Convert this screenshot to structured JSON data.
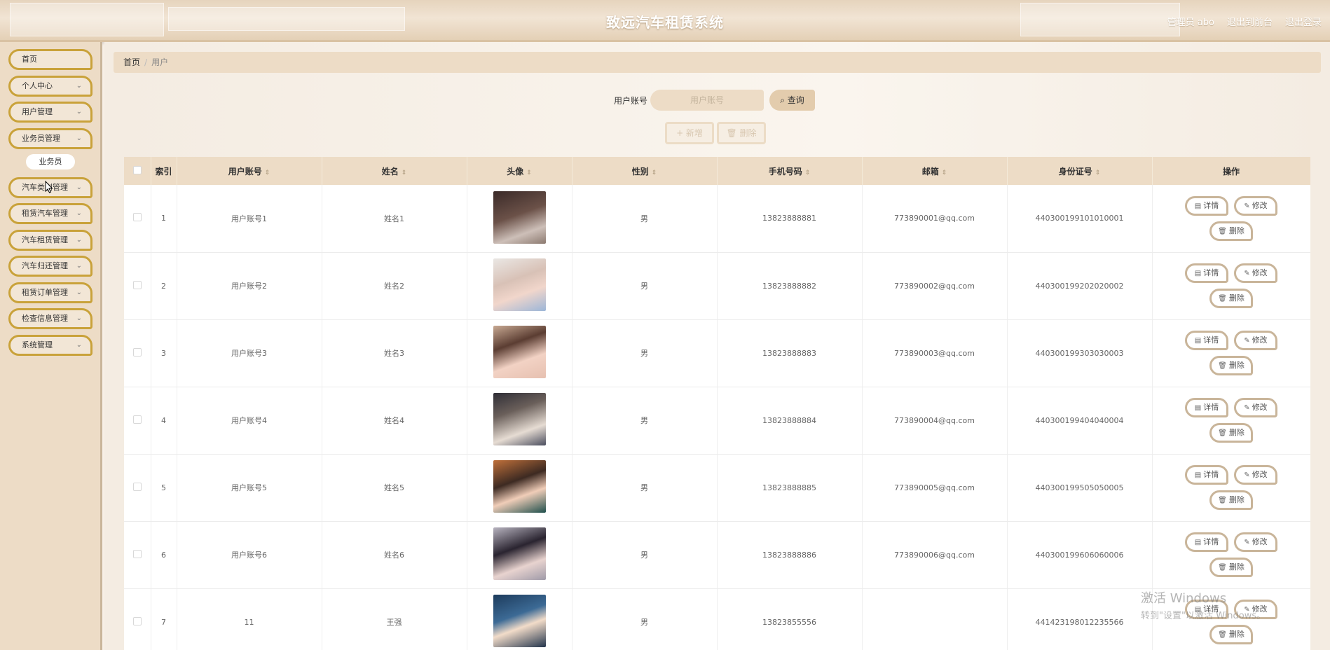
{
  "header": {
    "title": "致远汽车租赁系统",
    "admin": "管理员 abo",
    "to_front": "退出到前台",
    "logout": "退出登录"
  },
  "sidebar": {
    "items": [
      {
        "label": "首页",
        "chevron": false
      },
      {
        "label": "个人中心",
        "chevron": true
      },
      {
        "label": "用户管理",
        "chevron": true
      },
      {
        "label": "业务员管理",
        "chevron": true
      },
      {
        "label": "汽车类别管理",
        "chevron": true
      },
      {
        "label": "租赁汽车管理",
        "chevron": true
      },
      {
        "label": "汽车租赁管理",
        "chevron": true
      },
      {
        "label": "汽车归还管理",
        "chevron": true
      },
      {
        "label": "租赁订单管理",
        "chevron": true
      },
      {
        "label": "检查信息管理",
        "chevron": true
      },
      {
        "label": "系统管理",
        "chevron": true
      }
    ],
    "sub_item": "业务员"
  },
  "breadcrumb": {
    "home": "首页",
    "separator": "/",
    "current": "用户"
  },
  "search": {
    "label": "用户账号",
    "placeholder": "用户账号",
    "query_label": "查询",
    "query_icon": "search-icon"
  },
  "actions": {
    "add_label": "+ 新增",
    "delete_label": "删除"
  },
  "table": {
    "headers": [
      "索引",
      "用户账号",
      "姓名",
      "头像",
      "性别",
      "手机号码",
      "邮箱",
      "身份证号",
      "操作"
    ],
    "rows": [
      {
        "index": "1",
        "account": "用户账号1",
        "name": "姓名1",
        "gender": "男",
        "phone": "13823888881",
        "email": "773890001@qq.com",
        "idcard": "440300199101010001"
      },
      {
        "index": "2",
        "account": "用户账号2",
        "name": "姓名2",
        "gender": "男",
        "phone": "13823888882",
        "email": "773890002@qq.com",
        "idcard": "440300199202020002"
      },
      {
        "index": "3",
        "account": "用户账号3",
        "name": "姓名3",
        "gender": "男",
        "phone": "13823888883",
        "email": "773890003@qq.com",
        "idcard": "440300199303030003"
      },
      {
        "index": "4",
        "account": "用户账号4",
        "name": "姓名4",
        "gender": "男",
        "phone": "13823888884",
        "email": "773890004@qq.com",
        "idcard": "440300199404040004"
      },
      {
        "index": "5",
        "account": "用户账号5",
        "name": "姓名5",
        "gender": "男",
        "phone": "13823888885",
        "email": "773890005@qq.com",
        "idcard": "440300199505050005"
      },
      {
        "index": "6",
        "account": "用户账号6",
        "name": "姓名6",
        "gender": "男",
        "phone": "13823888886",
        "email": "773890006@qq.com",
        "idcard": "440300199606060006"
      },
      {
        "index": "7",
        "account": "11",
        "name": "王强",
        "gender": "男",
        "phone": "13823855556",
        "email": "",
        "idcard": "441423198012235566"
      }
    ],
    "op_labels": {
      "detail": "详情",
      "edit": "修改",
      "delete": "删除"
    }
  },
  "watermark": {
    "line1": "激活 Windows",
    "line2": "转到\"设置\"以激活 Windows。"
  },
  "colors": {
    "accent_border": "#c9a23a",
    "header_bg": "#e6d4bd",
    "sidebar_bg": "#eddcc6",
    "table_head_bg": "#eddcc6"
  }
}
